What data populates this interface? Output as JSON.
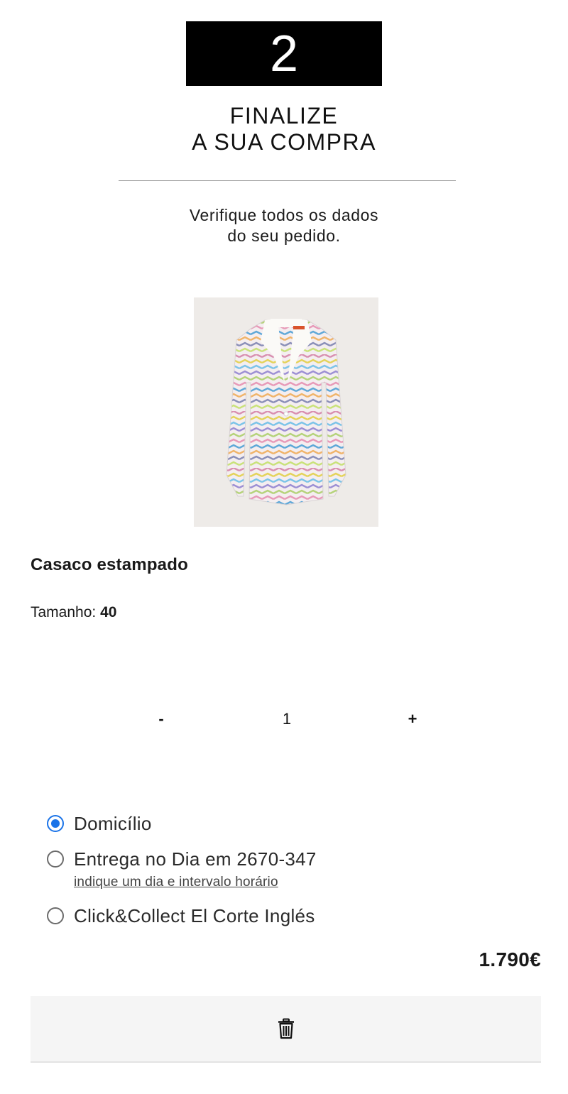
{
  "step": {
    "number": "2",
    "title_line1": "FINALIZE",
    "title_line2": "A SUA COMPRA",
    "subtitle_line1": "Verifique todos os dados",
    "subtitle_line2": "do seu pedido."
  },
  "product": {
    "name": "Casaco estampado",
    "size_label": "Tamanho:",
    "size_value": "40",
    "image_icon": "zigzag-print-blazer-image"
  },
  "quantity": {
    "minus_label": "-",
    "value": "1",
    "plus_label": "+"
  },
  "delivery": {
    "options": [
      {
        "label": "Domicílio",
        "selected": true
      },
      {
        "label": "Entrega no Dia em 2670-347",
        "link": "indique um dia e intervalo horário",
        "selected": false
      },
      {
        "label": "Click&Collect El Corte Inglés",
        "selected": false
      }
    ]
  },
  "price": "1.790€",
  "actions": {
    "delete_icon": "trash-icon"
  },
  "colors": {
    "radio_selected": "#1a73e8",
    "step_box": "#000000",
    "delete_bar": "#f5f5f5"
  }
}
